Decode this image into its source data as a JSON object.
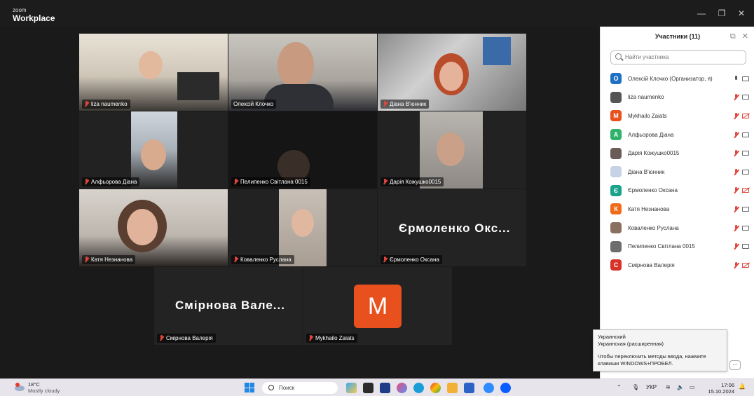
{
  "window": {
    "brand_small": "zoom",
    "brand_main": "Workplace"
  },
  "tiles": [
    {
      "name": "liza naumenko"
    },
    {
      "name": "Олексій Клочко"
    },
    {
      "name": "Діана В'юнник"
    },
    {
      "name": "Алфьорова Діана"
    },
    {
      "name": "Пелипенко Світлана 0015"
    },
    {
      "name": "Дарія Кожушко0015"
    },
    {
      "name": "Катя Незнанова"
    },
    {
      "name": "Коваленко Руслана"
    },
    {
      "name": "Єрмоленко Оксана",
      "big_label": "Єрмоленко Окс..."
    },
    {
      "name": "Смірнова Валерія",
      "big_label": "Смірнова Вале..."
    },
    {
      "name": "Mykhailo Zaiats",
      "avatar_letter": "M"
    }
  ],
  "panel": {
    "title": "Участники (11)",
    "search_placeholder": "Найти участника",
    "participants": [
      {
        "name": "Олексій Клочко (Организатор, я)",
        "initial": "О",
        "color": "#1f6fc5",
        "mic": "on",
        "cam": "on"
      },
      {
        "name": "liza naumenko",
        "initial": "",
        "color": "#555555",
        "mic": "off",
        "cam": "on"
      },
      {
        "name": "Mykhailo Zaiats",
        "initial": "M",
        "color": "#e8501e",
        "mic": "off",
        "cam": "off"
      },
      {
        "name": "Алфьорова Діана",
        "initial": "A",
        "color": "#2fb36b",
        "mic": "off",
        "cam": "on"
      },
      {
        "name": "Дарія Кожушко0015",
        "initial": "",
        "color": "#6a5d57",
        "mic": "off",
        "cam": "on"
      },
      {
        "name": "Діана В'юнник",
        "initial": "",
        "color": "#c8d2e6",
        "mic": "off",
        "cam": "on"
      },
      {
        "name": "Єрмоленко Оксана",
        "initial": "Є",
        "color": "#1aa38a",
        "mic": "off",
        "cam": "off"
      },
      {
        "name": "Катя Незнанова",
        "initial": "К",
        "color": "#ef6c1a",
        "mic": "off",
        "cam": "on"
      },
      {
        "name": "Коваленко Руслана",
        "initial": "",
        "color": "#8a7060",
        "mic": "off",
        "cam": "on"
      },
      {
        "name": "Пелипенко Світлана 0015",
        "initial": "",
        "color": "#6d6d6d",
        "mic": "off",
        "cam": "on"
      },
      {
        "name": "Смірнова Валерія",
        "initial": "С",
        "color": "#d6322a",
        "mic": "off",
        "cam": "off"
      }
    ]
  },
  "tooltip": {
    "line1": "Украинский",
    "line2": "Украинская (расширенная)",
    "line3": "Чтобы переключить методы ввода, нажмите клавиши WINDOWS+ПРОБЕЛ."
  },
  "taskbar": {
    "temp": "18°C",
    "weather": "Mostly cloudy",
    "search": "Поиск",
    "lang": "УКР",
    "time": "17:06",
    "date": "15.10.2024"
  }
}
